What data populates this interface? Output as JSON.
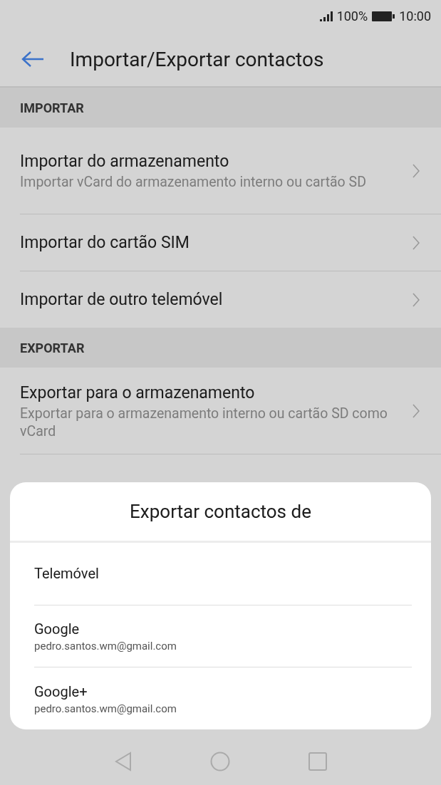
{
  "status_bar": {
    "battery": "100%",
    "time": "10:00"
  },
  "header": {
    "title": "Importar/Exportar contactos"
  },
  "sections": [
    {
      "title": "IMPORTAR",
      "items": [
        {
          "title": "Importar do armazenamento",
          "subtitle": "Importar vCard do armazenamento interno ou cartão SD"
        },
        {
          "title": "Importar do cartão SIM"
        },
        {
          "title": "Importar de outro telemóvel"
        }
      ]
    },
    {
      "title": "EXPORTAR",
      "items": [
        {
          "title": "Exportar para o armazenamento",
          "subtitle": "Exportar para o armazenamento interno ou cartão SD como vCard"
        }
      ]
    }
  ],
  "dialog": {
    "title": "Exportar contactos de",
    "options": [
      {
        "label": "Telemóvel"
      },
      {
        "label": "Google",
        "account": "pedro.santos.wm@gmail.com"
      },
      {
        "label": "Google+",
        "account": "pedro.santos.wm@gmail.com"
      }
    ]
  }
}
